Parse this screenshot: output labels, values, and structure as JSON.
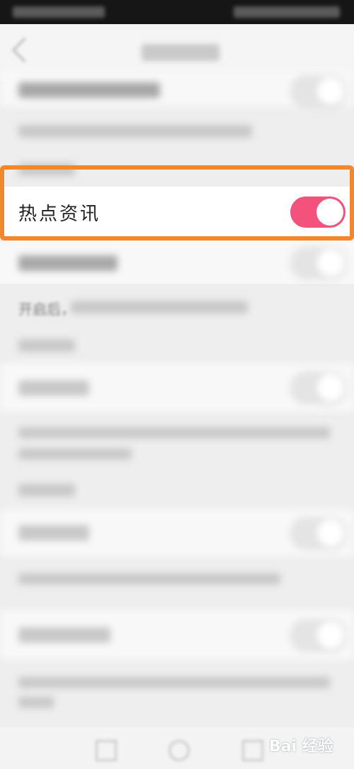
{
  "settings": {
    "hot_news": {
      "label": "热点资讯",
      "enabled": true,
      "accent_color": "#f2527c"
    },
    "blurred_fragment": {
      "text": "开启后，"
    }
  },
  "highlight_color": "#f0892e",
  "watermark": "Bai 经验"
}
